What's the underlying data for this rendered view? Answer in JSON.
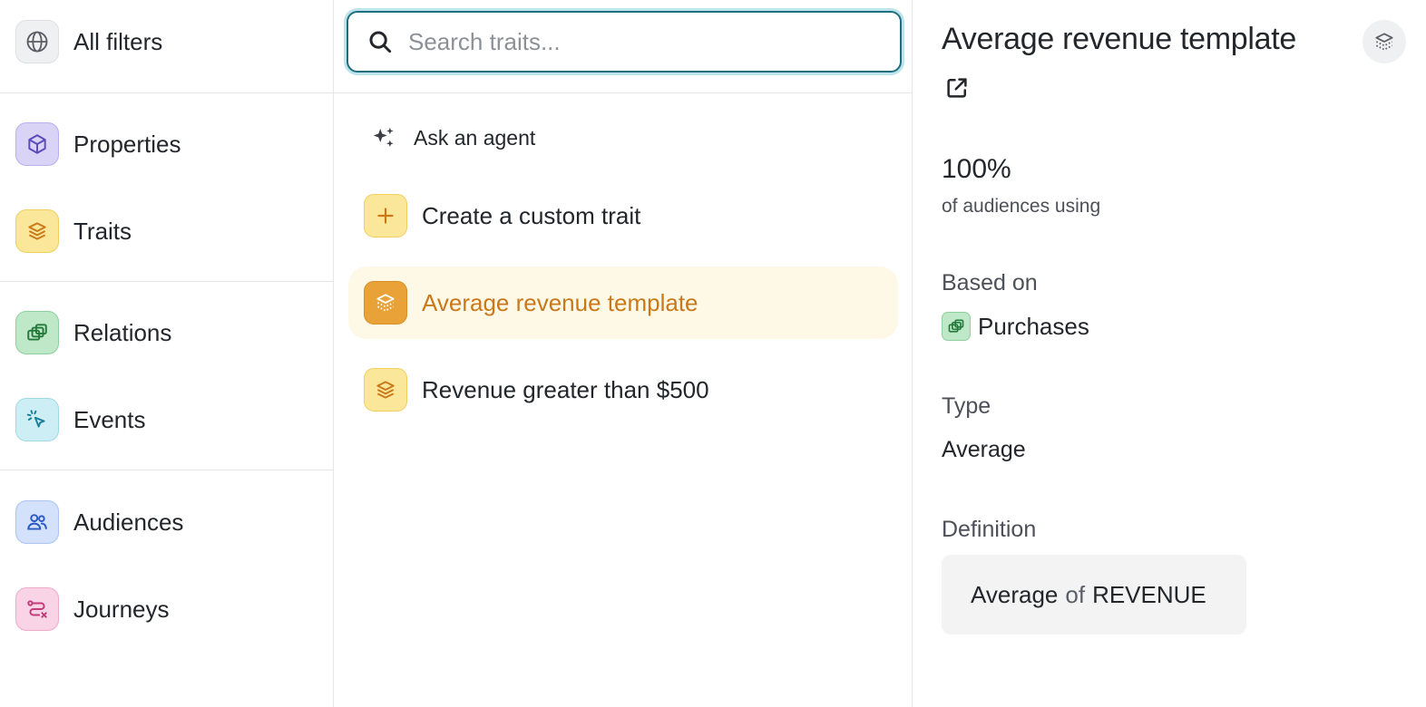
{
  "colors": {
    "accent_teal": "#1d6f80",
    "selected_row_bg": "#fef9e7",
    "selected_text": "#c9781a"
  },
  "filters": {
    "all": {
      "label": "All filters",
      "icon": "globe-icon"
    },
    "groups": [
      [
        {
          "key": "properties",
          "label": "Properties",
          "icon": "cube-icon",
          "color": "#d9d3f6"
        },
        {
          "key": "traits",
          "label": "Traits",
          "icon": "layers-icon",
          "color": "#fbe79a"
        }
      ],
      [
        {
          "key": "relations",
          "label": "Relations",
          "icon": "relations-icon",
          "color": "#bfe8c8"
        },
        {
          "key": "events",
          "label": "Events",
          "icon": "cursor-click-icon",
          "color": "#cdeef5"
        }
      ],
      [
        {
          "key": "audiences",
          "label": "Audiences",
          "icon": "users-icon",
          "color": "#d3e1fb"
        },
        {
          "key": "journeys",
          "label": "Journeys",
          "icon": "route-icon",
          "color": "#f8d4e6"
        }
      ]
    ]
  },
  "search": {
    "placeholder": "Search traits...",
    "value": ""
  },
  "list": {
    "agent_label": "Ask an agent",
    "items": [
      {
        "label": "Create a custom trait",
        "icon": "plus-icon",
        "selected": false
      },
      {
        "label": "Average revenue template",
        "icon": "template-icon",
        "selected": true
      },
      {
        "label": "Revenue greater than $500",
        "icon": "layers-icon",
        "selected": false
      }
    ]
  },
  "detail": {
    "title": "Average revenue template",
    "usage_percent": "100%",
    "usage_label": "of audiences using",
    "based_on_label": "Based on",
    "based_on_value": "Purchases",
    "type_label": "Type",
    "type_value": "Average",
    "definition_label": "Definition",
    "definition": {
      "func": "Average",
      "connector": "of",
      "column": "REVENUE"
    }
  }
}
